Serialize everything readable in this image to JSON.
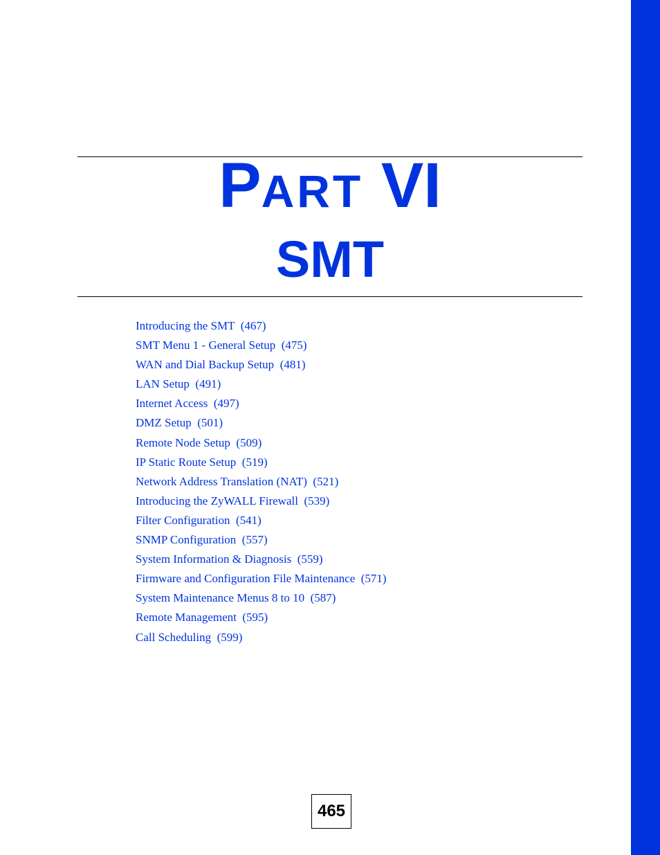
{
  "accent_color": "#0033dd",
  "header": {
    "part_first_letter": "P",
    "part_rest": "ART",
    "part_number": "VI",
    "subtitle": "SMT"
  },
  "toc": [
    {
      "title": "Introducing the SMT",
      "page": "(467)"
    },
    {
      "title": "SMT Menu 1 - General Setup",
      "page": "(475)"
    },
    {
      "title": "WAN and Dial Backup Setup",
      "page": "(481)"
    },
    {
      "title": "LAN Setup",
      "page": "(491)"
    },
    {
      "title": "Internet Access",
      "page": "(497)"
    },
    {
      "title": "DMZ Setup",
      "page": "(501)"
    },
    {
      "title": "Remote Node Setup",
      "page": "(509)"
    },
    {
      "title": "IP Static Route Setup",
      "page": "(519)"
    },
    {
      "title": "Network Address Translation (NAT)",
      "page": "(521)"
    },
    {
      "title": "Introducing the ZyWALL Firewall",
      "page": "(539)"
    },
    {
      "title": "Filter Configuration",
      "page": "(541)"
    },
    {
      "title": "SNMP Configuration",
      "page": "(557)"
    },
    {
      "title": "System Information & Diagnosis",
      "page": "(559)"
    },
    {
      "title": "Firmware and Configuration File Maintenance",
      "page": "(571)"
    },
    {
      "title": "System Maintenance Menus 8 to 10",
      "page": "(587)"
    },
    {
      "title": "Remote Management",
      "page": "(595)"
    },
    {
      "title": "Call Scheduling",
      "page": "(599)"
    }
  ],
  "footer": {
    "page_number": "465"
  }
}
